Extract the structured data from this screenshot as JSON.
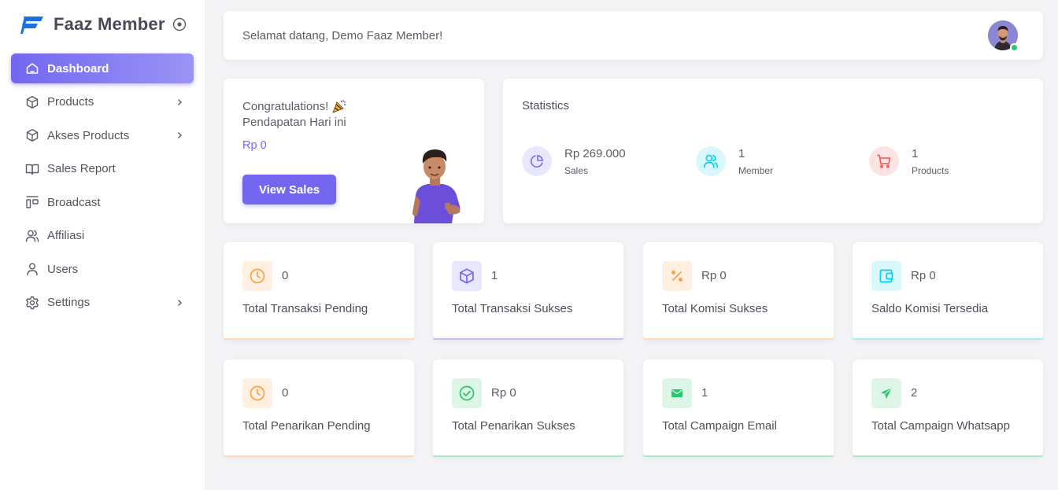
{
  "brand": {
    "name": "Faaz Member"
  },
  "sidebar": {
    "items": [
      {
        "label": "Dashboard",
        "icon": "home-icon",
        "active": true,
        "chevron": false
      },
      {
        "label": "Products",
        "icon": "box-icon",
        "active": false,
        "chevron": true
      },
      {
        "label": "Akses Products",
        "icon": "box-icon",
        "active": false,
        "chevron": true
      },
      {
        "label": "Sales Report",
        "icon": "book-icon",
        "active": false,
        "chevron": false
      },
      {
        "label": "Broadcast",
        "icon": "layout-icon",
        "active": false,
        "chevron": false
      },
      {
        "label": "Affiliasi",
        "icon": "users-icon",
        "active": false,
        "chevron": false
      },
      {
        "label": "Users",
        "icon": "user-icon",
        "active": false,
        "chevron": false
      },
      {
        "label": "Settings",
        "icon": "gear-icon",
        "active": false,
        "chevron": true
      }
    ]
  },
  "header": {
    "welcome": "Selamat datang, Demo Faaz Member!"
  },
  "congrats": {
    "line1": "Congratulations!",
    "line2": "Pendapatan Hari ini",
    "amount": "Rp 0",
    "button": "View Sales"
  },
  "statistics": {
    "title": "Statistics",
    "items": [
      {
        "value": "Rp 269.000",
        "label": "Sales",
        "icon": "pie-chart-icon",
        "color": "#7367f0",
        "bg": "#e9e7fd"
      },
      {
        "value": "1",
        "label": "Member",
        "icon": "users-icon",
        "color": "#00cfe8",
        "bg": "#d9f8fc"
      },
      {
        "value": "1",
        "label": "Products",
        "icon": "cart-icon",
        "color": "#ea5455",
        "bg": "#fce4e4"
      }
    ]
  },
  "cards": [
    {
      "value": "0",
      "label": "Total Transaksi Pending",
      "icon": "clock-icon",
      "color": "#ff9f43",
      "bg": "#fff0e1"
    },
    {
      "value": "1",
      "label": "Total Transaksi Sukses",
      "icon": "box-icon",
      "color": "#7367f0",
      "bg": "#e9e7fd"
    },
    {
      "value": "Rp 0",
      "label": "Total Komisi Sukses",
      "icon": "percent-icon",
      "color": "#ff9f43",
      "bg": "#fff0e1"
    },
    {
      "value": "Rp 0",
      "label": "Saldo Komisi Tersedia",
      "icon": "wallet-icon",
      "color": "#00cfe8",
      "bg": "#d9f8fc"
    },
    {
      "value": "0",
      "label": "Total Penarikan Pending",
      "icon": "clock-icon",
      "color": "#ff9f43",
      "bg": "#fff0e1"
    },
    {
      "value": "Rp 0",
      "label": "Total Penarikan Sukses",
      "icon": "check-circle-icon",
      "color": "#28c76f",
      "bg": "#ddf6e8"
    },
    {
      "value": "1",
      "label": "Total Campaign Email",
      "icon": "envelope-icon",
      "color": "#28c76f",
      "bg": "#ddf6e8"
    },
    {
      "value": "2",
      "label": "Total Campaign Whatsapp",
      "icon": "send-icon",
      "color": "#28c76f",
      "bg": "#ddf6e8"
    }
  ],
  "colors": {
    "primary": "#7367f0",
    "online": "#28c76f"
  }
}
